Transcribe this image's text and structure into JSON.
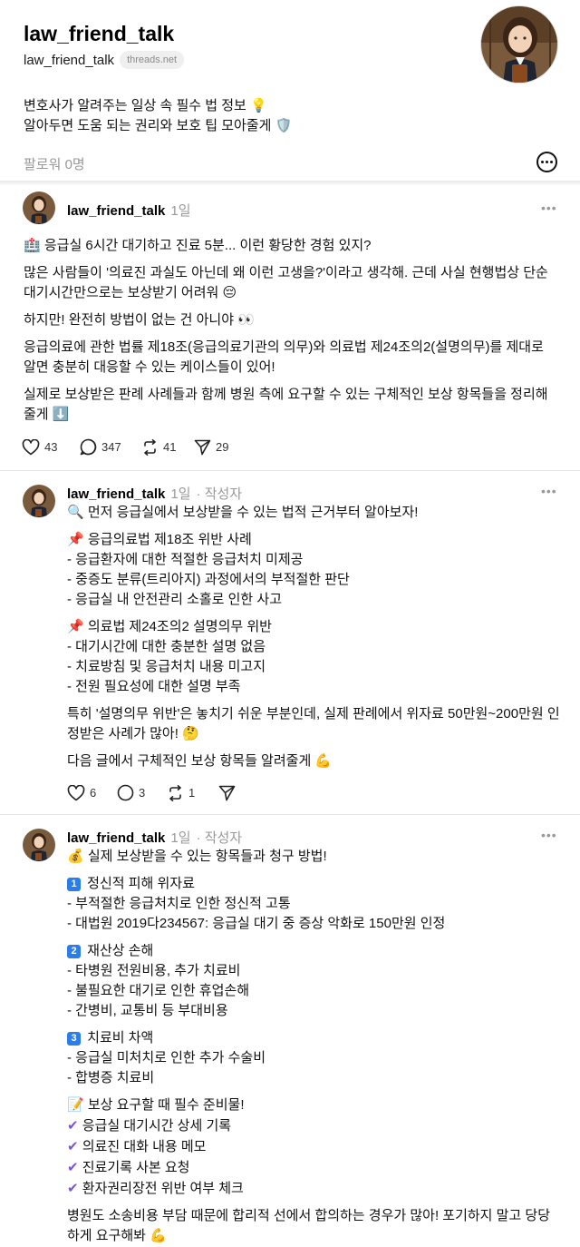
{
  "profile": {
    "name": "law_friend_talk",
    "handle": "law_friend_talk",
    "domain": "threads.net",
    "bio_line1": "변호사가 알려주는 일상 속 필수 법 정보 💡",
    "bio_line2": "알아두면 도움 되는 권리와 보호 팁 모아줄게 🛡️",
    "followers": "팔로워 0명"
  },
  "posts": [
    {
      "user": "law_friend_talk",
      "time": "1일",
      "lines": [
        "🏥 응급실 6시간 대기하고 진료 5분... 이런 황당한 경험 있지?",
        "많은 사람들이 '의료진 과실도 아닌데 왜 이런 고생을?'이라고 생각해. 근데 사실 현행법상 단순 대기시간만으로는 보상받기 어려워 😔",
        "하지만! 완전히 방법이 없는 건 아니야 👀",
        "응급의료에 관한 법률 제18조(응급의료기관의 의무)와 의료법 제24조의2(설명의무)를 제대로 알면 충분히 대응할 수 있는 케이스들이 있어!",
        "실제로 보상받은 판례 사례들과 함께 병원 측에 요구할 수 있는 구체적인 보상 항목들을 정리해줄게 ⬇️"
      ],
      "likes": "43",
      "replies": "347",
      "reposts": "41",
      "shares": "29"
    },
    {
      "user": "law_friend_talk",
      "time": "1일",
      "author": "· 작성자",
      "intro": "🔍 먼저 응급실에서 보상받을 수 있는 법적 근거부터 알아보자!",
      "section1_title": "📌 응급의료법 제18조 위반 사례",
      "section1_items": [
        "- 응급환자에 대한 적절한 응급처치 미제공",
        "- 중증도 분류(트리아지) 과정에서의 부적절한 판단",
        "- 응급실 내 안전관리 소홀로 인한 사고"
      ],
      "section2_title": "📌 의료법 제24조의2 설명의무 위반",
      "section2_items": [
        "- 대기시간에 대한 충분한 설명 없음",
        "- 치료방침 및 응급처치 내용 미고지",
        "- 전원 필요성에 대한 설명 부족"
      ],
      "para1": "특히 '설명의무 위반'은 놓치기 쉬운 부분인데, 실제 판례에서 위자료 50만원~200만원 인정받은 사례가 많아! 🤔",
      "para2": "다음 글에서 구체적인 보상 항목들 알려줄게 💪",
      "likes": "6",
      "replies": "3",
      "reposts": "1"
    },
    {
      "user": "law_friend_talk",
      "time": "1일",
      "author": "· 작성자",
      "intro": "💰 실제 보상받을 수 있는 항목들과 청구 방법!",
      "s1_num": "1",
      "s1_title": "정신적 피해 위자료",
      "s1_items": [
        "- 부적절한 응급처치로 인한 정신적 고통",
        "- 대법원 2019다234567: 응급실 대기 중 증상 악화로 150만원 인정"
      ],
      "s2_num": "2",
      "s2_title": "재산상 손해",
      "s2_items": [
        "- 타병원 전원비용, 추가 치료비",
        "- 불필요한 대기로 인한 휴업손해",
        "- 간병비, 교통비 등 부대비용"
      ],
      "s3_num": "3",
      "s3_title": "치료비 차액",
      "s3_items": [
        "- 응급실 미처치로 인한 추가 수술비",
        "- 합병증 치료비"
      ],
      "prep_title": "📝 보상 요구할 때 필수 준비물!",
      "prep_items": [
        "응급실 대기시간 상세 기록",
        "의료진 대화 내용 메모",
        "진료기록 사본 요청",
        "환자권리장전 위반 여부 체크"
      ],
      "closing": "병원도 소송비용 부담 때문에 합리적 선에서 합의하는 경우가 많아! 포기하지 말고 당당하게 요구해봐 💪"
    }
  ],
  "colors": {
    "accent_check": "#7b55d6",
    "keycap": "#2b7de9",
    "muted": "#999999"
  },
  "icons": [
    "heart-icon",
    "comment-icon",
    "repost-icon",
    "share-icon",
    "more-icon"
  ]
}
